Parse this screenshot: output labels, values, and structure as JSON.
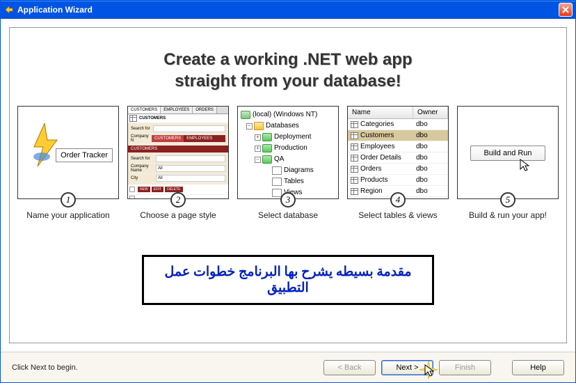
{
  "title": "Application Wizard",
  "headline_line1": "Create a working .NET web app",
  "headline_line2": "straight from your database!",
  "steps": {
    "s1": {
      "label": "Name your application",
      "num": "1",
      "app_name": "Order Tracker"
    },
    "s2": {
      "label": "Choose a page style",
      "num": "2",
      "tabs": [
        "CUSTOMERS",
        "EMPLOYEES",
        "ORDERS"
      ],
      "section": "CUSTOMERS",
      "search_label": "Search for",
      "company_label": "Company N",
      "subtabs": [
        "CUSTOMERS",
        "EMPLOYEES"
      ],
      "subsection": "CUSTOMERS",
      "fields": [
        "Company Name",
        "City"
      ],
      "val_all": "All",
      "btns": [
        "NEW",
        "EDIT",
        "DELETE"
      ]
    },
    "s3": {
      "label": "Select database",
      "num": "3",
      "root": "(local) (Windows NT)",
      "databases": "Databases",
      "items": [
        "Deployment",
        "Production",
        "QA"
      ],
      "qa_children": [
        "Diagrams",
        "Tables",
        "Views"
      ]
    },
    "s4": {
      "label": "Select tables & views",
      "num": "4",
      "col1": "Name",
      "col2": "Owner",
      "rows": [
        {
          "name": "Categories",
          "owner": "dbo",
          "sel": false
        },
        {
          "name": "Customers",
          "owner": "dbo",
          "sel": true
        },
        {
          "name": "Employees",
          "owner": "dbo",
          "sel": false
        },
        {
          "name": "Order Details",
          "owner": "dbo",
          "sel": false
        },
        {
          "name": "Orders",
          "owner": "dbo",
          "sel": false
        },
        {
          "name": "Products",
          "owner": "dbo",
          "sel": false
        },
        {
          "name": "Region",
          "owner": "dbo",
          "sel": false
        }
      ]
    },
    "s5": {
      "label": "Build & run your app!",
      "num": "5",
      "button": "Build and Run"
    }
  },
  "arabic_text": "مقدمة بسيطه يشرح بها البرنامج خطوات عمل التطبيق",
  "status": "Click Next to begin.",
  "buttons": {
    "back": "< Back",
    "next": "Next >",
    "finish": "Finish",
    "help": "Help"
  }
}
